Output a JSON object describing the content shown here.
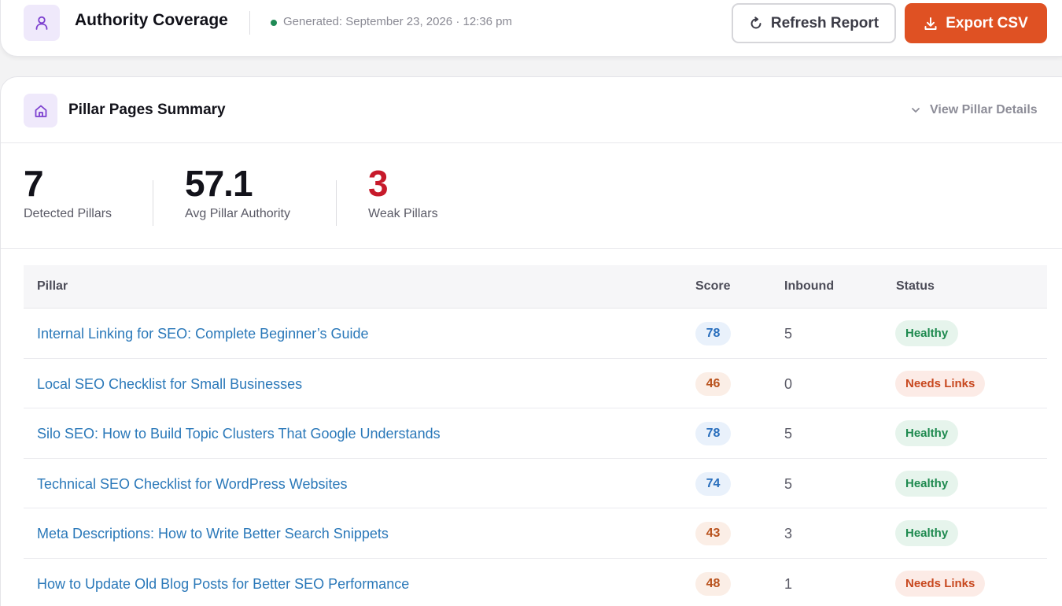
{
  "header": {
    "title": "Authority Coverage",
    "generated": "Generated: September 23, 2026 · 12:36 pm",
    "refresh_label": "Refresh Report",
    "export_label": "Export CSV"
  },
  "summary": {
    "title": "Pillar Pages Summary",
    "details_link": "View Pillar Details",
    "stats": [
      {
        "value": "7",
        "label": "Detected Pillars"
      },
      {
        "value": "57.1",
        "label": "Avg Pillar Authority"
      },
      {
        "value": "3",
        "label": "Weak Pillars"
      }
    ]
  },
  "table": {
    "columns": [
      "Pillar",
      "Score",
      "Inbound",
      "Status"
    ],
    "rows": [
      {
        "pillar": "Internal Linking for SEO: Complete Beginner’s Guide",
        "score": "78",
        "score_tone": "blue",
        "inbound": "5",
        "status": "Healthy",
        "status_tone": "healthy"
      },
      {
        "pillar": "Local SEO Checklist for Small Businesses",
        "score": "46",
        "score_tone": "orange",
        "inbound": "0",
        "status": "Needs Links",
        "status_tone": "needs"
      },
      {
        "pillar": "Silo SEO: How to Build Topic Clusters That Google Understands",
        "score": "78",
        "score_tone": "blue",
        "inbound": "5",
        "status": "Healthy",
        "status_tone": "healthy"
      },
      {
        "pillar": "Technical SEO Checklist for WordPress Websites",
        "score": "74",
        "score_tone": "blue",
        "inbound": "5",
        "status": "Healthy",
        "status_tone": "healthy"
      },
      {
        "pillar": "Meta Descriptions: How to Write Better Search Snippets",
        "score": "43",
        "score_tone": "orange",
        "inbound": "3",
        "status": "Healthy",
        "status_tone": "healthy"
      },
      {
        "pillar": "How to Update Old Blog Posts for Better SEO Performance",
        "score": "48",
        "score_tone": "orange",
        "inbound": "1",
        "status": "Needs Links",
        "status_tone": "needs"
      }
    ]
  },
  "colors": {
    "accent": "#df5123",
    "link": "#2a78b9",
    "weak": "#c71a2b",
    "healthy": "#1e8a4f",
    "needs": "#c8481f"
  },
  "icons": {
    "app": "user-icon",
    "summary": "home-icon",
    "refresh": "refresh-icon",
    "export": "download-icon",
    "details": "chevron-down-icon"
  }
}
